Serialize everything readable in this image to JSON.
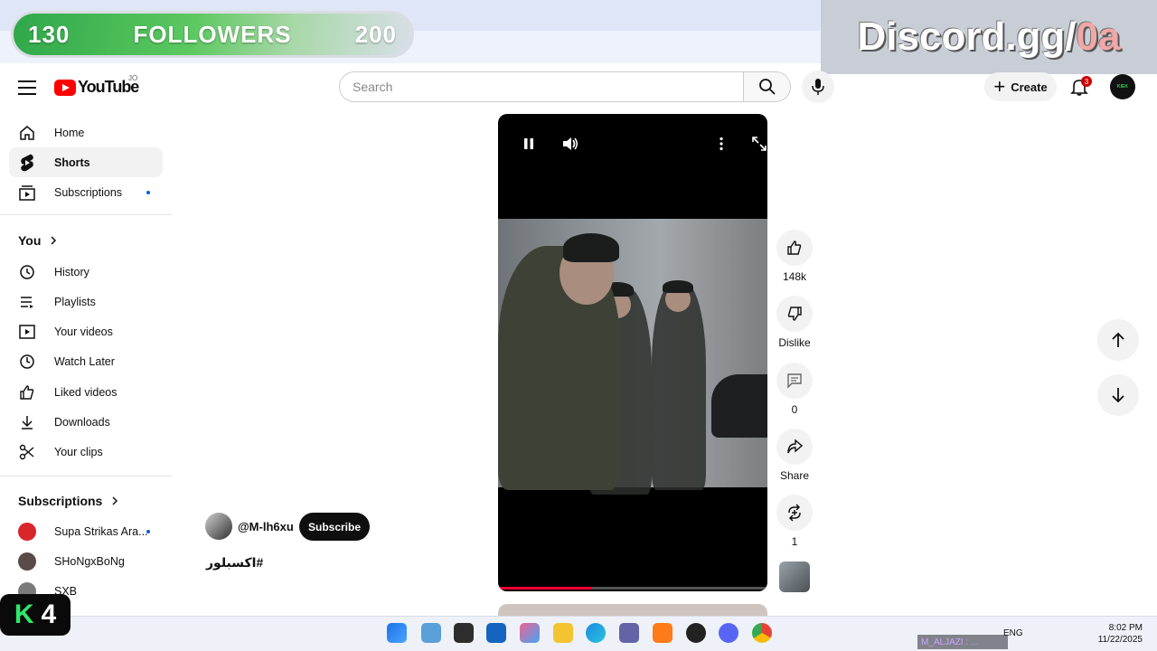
{
  "overlay": {
    "followers_current": "130",
    "followers_label": "FOLLOWERS",
    "followers_goal": "200",
    "discord_prefix": "Discord.gg/",
    "discord_suffix": "0a",
    "k4_k": "K",
    "k4_num": "4",
    "streamer_tag": "M_ALJAZI : ..."
  },
  "header": {
    "logo_text": "YouTube",
    "region": "JO",
    "search_placeholder": "Search",
    "create_label": "Create",
    "notification_count": "3",
    "avatar_text": "KIEK"
  },
  "sidebar": {
    "main": [
      {
        "label": "Home",
        "icon": "home-icon"
      },
      {
        "label": "Shorts",
        "icon": "shorts-icon",
        "active": true
      },
      {
        "label": "Subscriptions",
        "icon": "subscriptions-icon",
        "dot": true
      }
    ],
    "you_heading": "You",
    "you": [
      {
        "label": "History",
        "icon": "history-icon"
      },
      {
        "label": "Playlists",
        "icon": "playlists-icon"
      },
      {
        "label": "Your videos",
        "icon": "your-videos-icon"
      },
      {
        "label": "Watch Later",
        "icon": "clock-icon"
      },
      {
        "label": "Liked videos",
        "icon": "like-icon"
      },
      {
        "label": "Downloads",
        "icon": "download-icon"
      },
      {
        "label": "Your clips",
        "icon": "scissors-icon"
      }
    ],
    "subscriptions_heading": "Subscriptions",
    "subscriptions": [
      {
        "label": "Supa Strikas Ara...",
        "color": "#d8262b",
        "dot": true
      },
      {
        "label": "SHoNgxBoNg",
        "color": "#5a4a4a"
      },
      {
        "label": "SXB",
        "color": "#7a7a7a"
      }
    ]
  },
  "short": {
    "channel": "@M-lh6xu",
    "subscribe_label": "Subscribe",
    "title": "#اكسبلور",
    "progress": 0.35,
    "actions": {
      "like_count": "148k",
      "dislike_label": "Dislike",
      "comment_count": "0",
      "share_label": "Share",
      "remix_count": "1"
    }
  },
  "taskbar": {
    "lang": "ENG",
    "time": "8:02 PM",
    "date": "11/22/2025"
  }
}
